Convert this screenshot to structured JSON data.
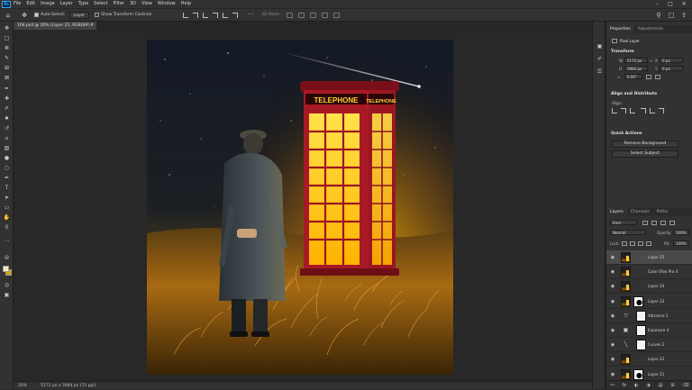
{
  "menubar": {
    "logo": "Ps",
    "items": [
      "File",
      "Edit",
      "Image",
      "Layer",
      "Type",
      "Select",
      "Filter",
      "3D",
      "View",
      "Window",
      "Help"
    ],
    "window_controls": [
      "–",
      "□",
      "✕"
    ]
  },
  "options_bar": {
    "auto_select_label": "Auto-Select:",
    "auto_select_target": "Layer",
    "transform_controls_label": "Show Transform Controls",
    "mode_3d_label": "3D Mode:",
    "more_label": "•••"
  },
  "document": {
    "tab_title": "104.psd @ 26% (Layer 25, RGB/8#) *",
    "close_glyph": "×"
  },
  "artwork": {
    "booth_sign_left": "TELEPHONE",
    "booth_sign_right": "TELEPHONE"
  },
  "status": {
    "zoom": "26%",
    "doc_size": "5172 px x 3984 px (72 ppi)"
  },
  "properties": {
    "tabs": [
      "Properties",
      "Adjustments"
    ],
    "layer_type": "Pixel Layer",
    "transform_title": "Transform",
    "w_label": "W",
    "w_value": "5172 px",
    "h_label": "H",
    "h_value": "3984 px",
    "x_label": "X",
    "x_value": "0 px",
    "y_label": "Y",
    "y_value": "0 px",
    "angle_value": "0.00°",
    "align_title": "Align and Distribute",
    "align_label": "Align:",
    "quick_actions_title": "Quick Actions",
    "remove_bg_label": "Remove Background",
    "select_subject_label": "Select Subject"
  },
  "layers_panel": {
    "tabs": [
      "Layers",
      "Channels",
      "Paths"
    ],
    "filter_label": "Kind",
    "blend_mode": "Normal",
    "opacity_label": "Opacity:",
    "opacity_value": "100%",
    "lock_label": "Lock:",
    "fill_label": "Fill:",
    "fill_value": "100%",
    "layers": [
      {
        "name": "Layer 25",
        "kind": "pixel",
        "selected": true
      },
      {
        "name": "Color Efex Pro 4",
        "kind": "pixel",
        "selected": false
      },
      {
        "name": "Layer 24",
        "kind": "pixel",
        "selected": false
      },
      {
        "name": "Layer 23",
        "kind": "masked",
        "selected": false
      },
      {
        "name": "Vibrance 1",
        "kind": "adjustment",
        "icon": "vibrance-icon",
        "selected": false
      },
      {
        "name": "Exposure 4",
        "kind": "adjustment",
        "icon": "exposure-icon",
        "selected": false
      },
      {
        "name": "Curves 2",
        "kind": "adjustment",
        "icon": "curves-icon",
        "selected": false
      },
      {
        "name": "Layer 22",
        "kind": "pixel",
        "selected": false
      },
      {
        "name": "Layer 21",
        "kind": "masked",
        "selected": false
      }
    ]
  },
  "colors": {
    "foreground": "#f4e9c0",
    "background": "#d9a400",
    "accent": "#31a8ff",
    "booth_red": "#9c1622",
    "booth_glow": "#ffd200"
  }
}
